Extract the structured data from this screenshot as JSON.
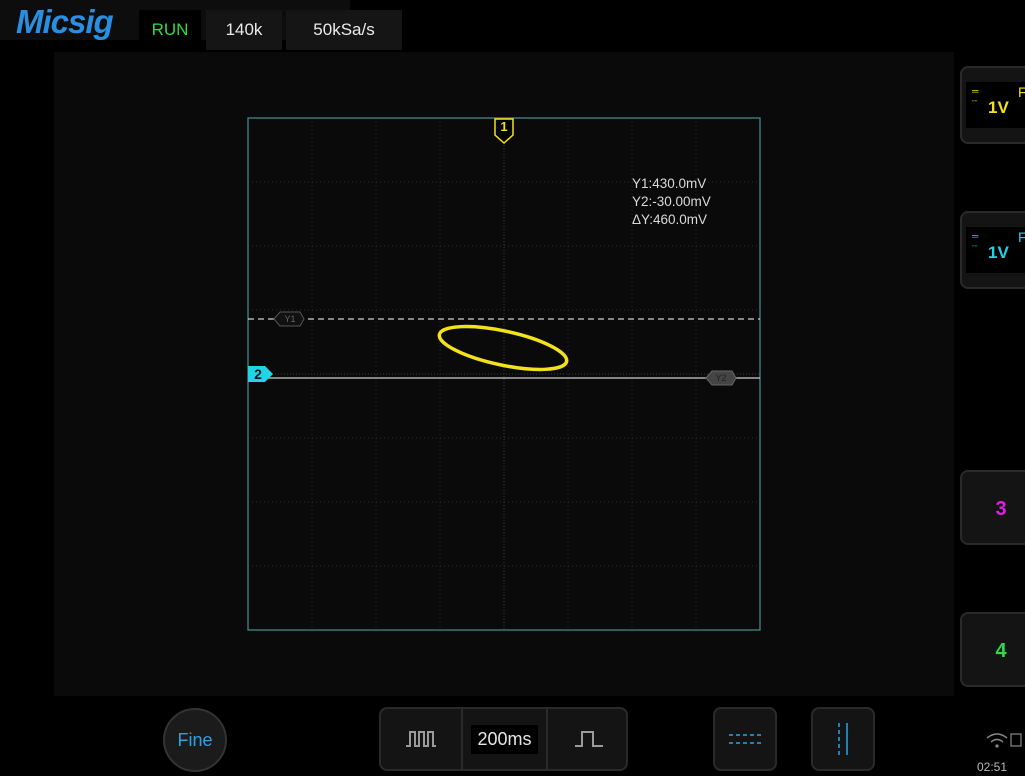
{
  "topbar": {
    "logo": "Micsig",
    "run_state": "RUN",
    "memory_depth": "140k",
    "sample_rate": "50kSa/s"
  },
  "display": {
    "mode": "XY",
    "ch1_marker": "1",
    "ch2_marker": "2",
    "cursor_y1_tag": "Y1",
    "cursor_y2_tag": "Y2",
    "cursor_readout": {
      "y1": "Y1:430.0mV",
      "y2": "Y2:-30.00mV",
      "delta_y": "ΔY:460.0mV"
    },
    "colors": {
      "ch1": "#f2e21b",
      "ch2": "#22d3e6",
      "grid_border": "#4a8f96",
      "cursor": "#cfcfcf"
    }
  },
  "sidebar": {
    "channels": [
      {
        "label": "1",
        "scale": "1V",
        "mode": "F",
        "color": "#f2e21b"
      },
      {
        "label": "2",
        "scale": "1V",
        "mode": "F",
        "color": "#22d3e6"
      },
      {
        "label": "3",
        "color": "#e01ee0"
      },
      {
        "label": "4",
        "color": "#2fd94a"
      }
    ]
  },
  "bottombar": {
    "fine_label": "Fine",
    "timebase": "200ms",
    "zoom_in_icon": "pulse-wide-icon",
    "zoom_out_icon": "pulse-narrow-icon",
    "hcursor_icon": "horizontal-cursor-icon",
    "vcursor_icon": "vertical-cursor-icon",
    "clock": "02:51"
  }
}
